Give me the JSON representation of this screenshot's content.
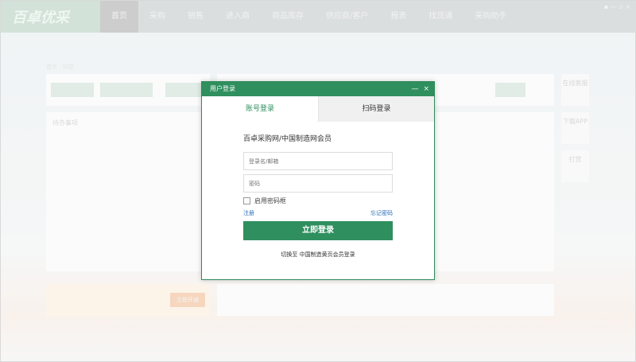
{
  "app": {
    "logo": "百卓优采",
    "nav": [
      "首页",
      "采购",
      "销售",
      "进入商",
      "商品库存",
      "供应商/客户",
      "报表",
      "找货通",
      "采购助手"
    ],
    "active_nav": 0,
    "bg": {
      "breadcrumb": "首页 · 快捷",
      "todo_title": "待办事项",
      "side": [
        "在线客服",
        "下载APP",
        "打赏"
      ],
      "promo_btn": "立即开通"
    }
  },
  "dialog": {
    "title": "用户登录",
    "minimize": "—",
    "close": "×",
    "tabs": [
      "账号登录",
      "扫码登录"
    ],
    "heading": "百卓采购网/中国制造网会员",
    "username_placeholder": "登录名/邮箱",
    "password_placeholder": "密码",
    "remember": "启用密码框",
    "register": "注册",
    "forgot": "忘记密码",
    "login_button": "立即登录",
    "switch_link": "切换至 中国制造黄页会员登录"
  },
  "colors": {
    "brand": "#2f8f5e",
    "link": "#2a6fb8"
  }
}
